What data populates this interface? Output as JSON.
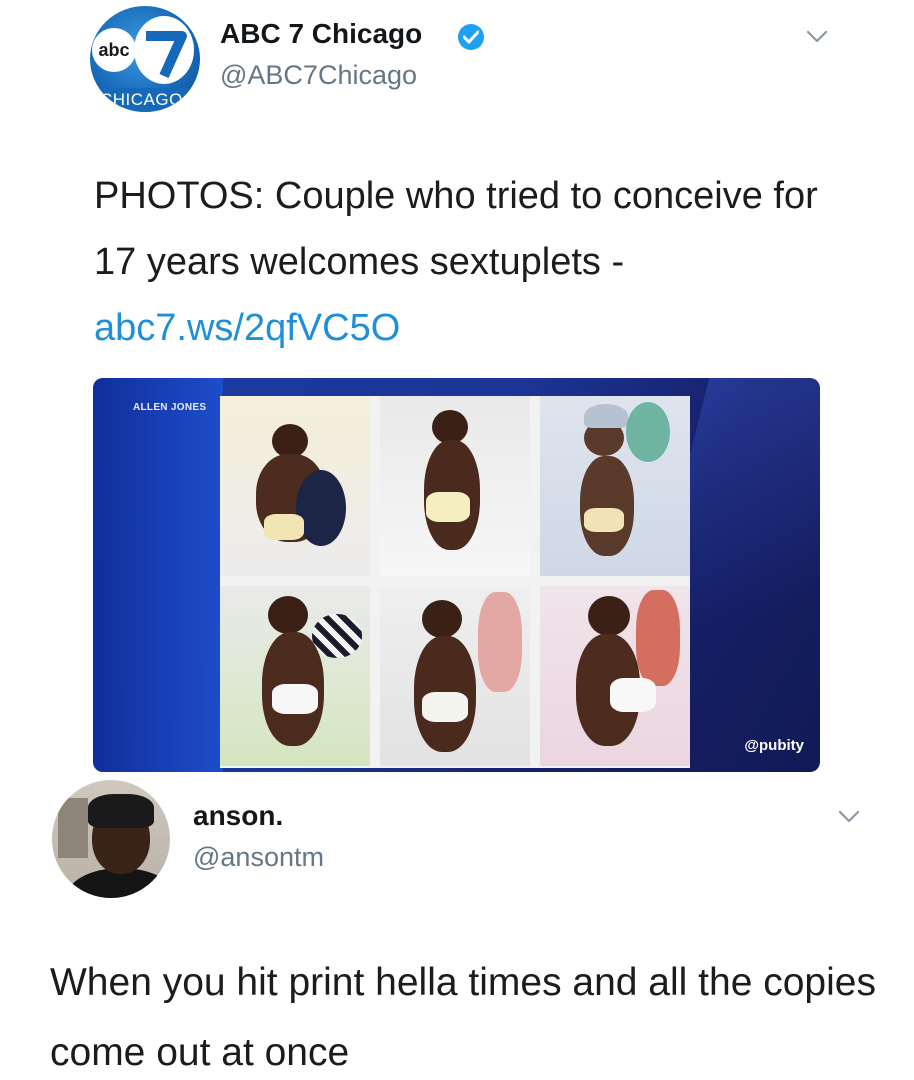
{
  "tweet": {
    "author_name": "ABC 7 Chicago",
    "author_handle": "@ABC7Chicago",
    "avatar": {
      "logo_text": "abc",
      "band_text": "CHICAGO"
    },
    "verified_icon": "verified-badge-icon",
    "menu_icon": "chevron-down-icon",
    "text": "PHOTOS: Couple who tried to conceive for 17 years welcomes sextuplets - ",
    "link": "abc7.ws/2qfVC5O",
    "media": {
      "credit": "ALLEN JONES",
      "watermark": "@pubity",
      "photo_count": 6
    }
  },
  "reply": {
    "author_name": "anson.",
    "author_handle": "@ansontm",
    "menu_icon": "chevron-down-icon",
    "text": "When you hit print hella times and all the copies come out at once"
  },
  "colors": {
    "link": "#1f8fd8",
    "handle": "#657786",
    "verified": "#1da1f2",
    "card_bg": "#1c3596"
  }
}
